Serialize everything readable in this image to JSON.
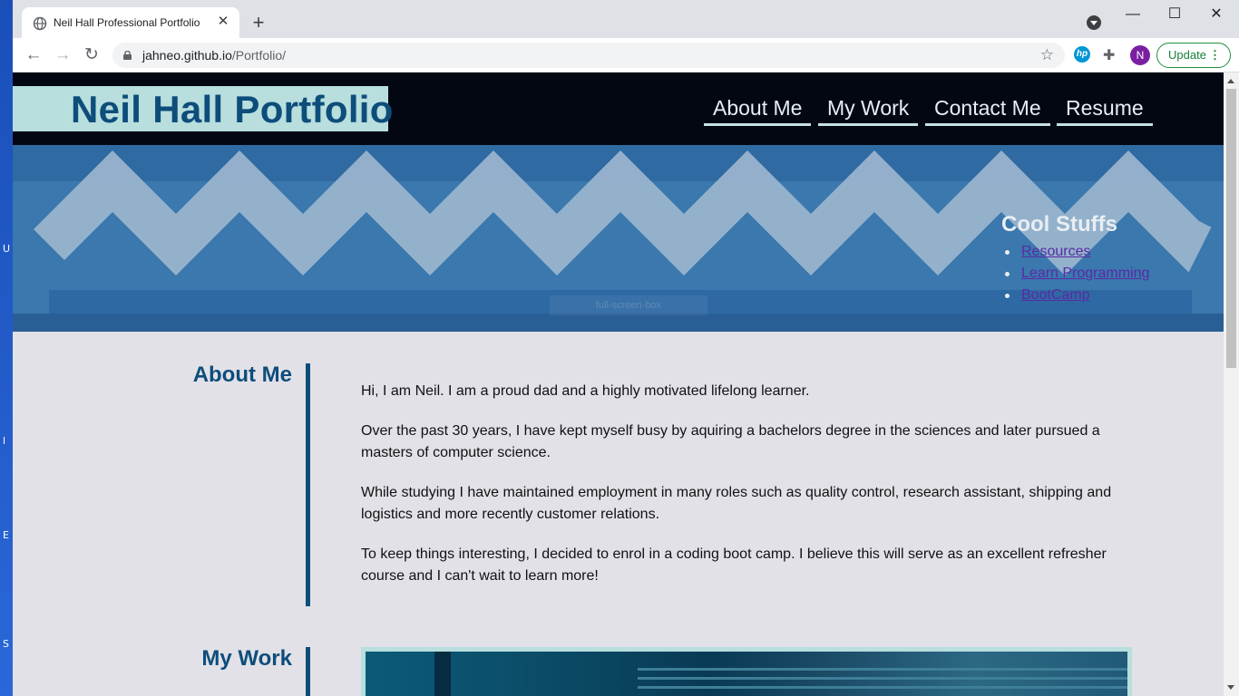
{
  "browser": {
    "tab_title": "Neil Hall Professional Portfolio",
    "url_host": "jahneo.github.io",
    "url_path": "/Portfolio/",
    "profile_initial": "N",
    "update_label": "Update",
    "hp_label": "hp"
  },
  "site": {
    "brand": "Neil Hall Portfolio",
    "nav": [
      "About Me",
      "My Work",
      "Contact Me",
      "Resume"
    ],
    "hero": {
      "heading": "Cool Stuffs",
      "links": [
        "Resources",
        "Learn Programming",
        "BootCamp"
      ],
      "faint_label": "full-screen-box"
    },
    "about": {
      "title": "About Me",
      "paragraphs": [
        "Hi, I am Neil. I am a proud dad and a highly motivated lifelong learner.",
        "Over the past 30 years, I have kept myself busy by aquiring a bachelors degree in the sciences and later pursued a masters of computer science.",
        "While studying I have maintained employment in many roles such as quality control, research assistant, shipping and logistics and more recently customer relations.",
        "To keep things interesting, I decided to enrol in a coding boot camp. I believe this will serve as an excellent refresher course and I can't wait to learn more!"
      ]
    },
    "work": {
      "title": "My Work"
    }
  },
  "colors": {
    "header_bg": "#030712",
    "brand_bg": "#b8dede",
    "accent_blue": "#0d4d7a",
    "page_bg": "#e2e1e8",
    "link_purple": "#5a2aa6"
  }
}
